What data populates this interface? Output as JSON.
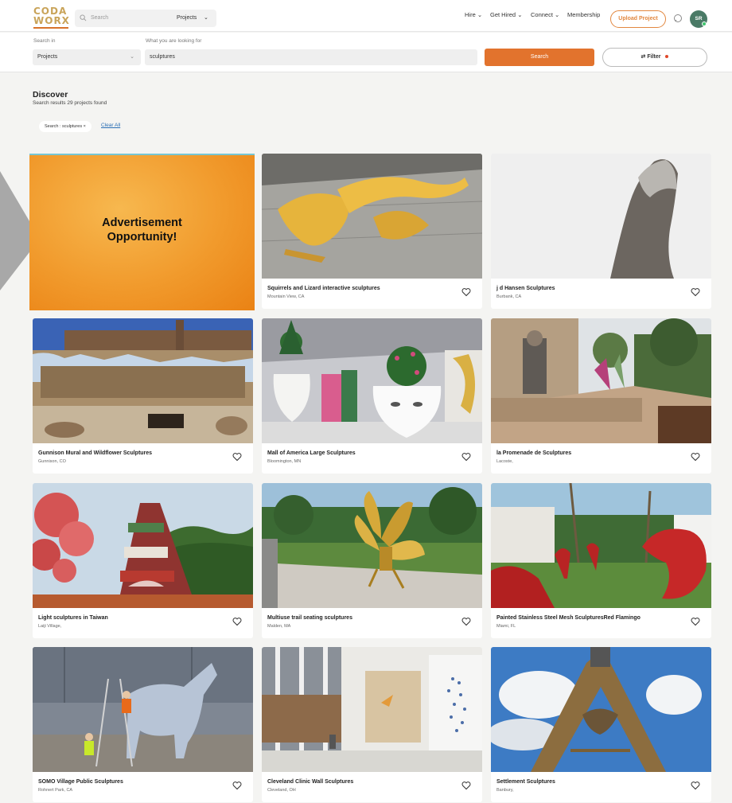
{
  "header": {
    "logo_line1": "CODA",
    "logo_line2": "WORX",
    "search_placeholder": "Search",
    "search_scope": "Projects",
    "nav": [
      "Hire",
      "Get Hired",
      "Connect",
      "Membership"
    ],
    "upload_label": "Upload Project",
    "avatar_initials": "SR"
  },
  "search": {
    "search_in_label": "Search in",
    "search_in_value": "Projects",
    "what_label": "What you are looking for",
    "what_value": "sculptures",
    "search_button": "Search",
    "filter_button": "Filter"
  },
  "discover": {
    "title": "Discover",
    "subtitle": "Search results 29 projects found",
    "chip": "Search : sculptures",
    "clear_all": "Clear All"
  },
  "ad": {
    "line1": "Advertisement",
    "line2": "Opportunity!"
  },
  "cards": [
    {
      "title": "Squirrels and Lizard interactive sculptures",
      "location": "Mountain View, CA"
    },
    {
      "title": "j d Hansen Sculptures",
      "location": "Burbank, CA"
    },
    {
      "title": "Gunnison Mural and Wildflower Sculptures",
      "location": "Gunnison, CO"
    },
    {
      "title": "Mall of America Large Sculptures",
      "location": "Bloomington, MN"
    },
    {
      "title": "la Promenade de Sculptures",
      "location": "Lacoste,"
    },
    {
      "title": "Light sculptures in Taiwan",
      "location": "Laiji Village,"
    },
    {
      "title": "Multiuse trail seating sculptures",
      "location": "Malden, MA"
    },
    {
      "title": "Painted Stainless Steel Mesh SculpturesRed Flamingo",
      "location": "Miami, FL"
    },
    {
      "title": "SOMO Village Public Sculptures",
      "location": "Rohnert Park, CA"
    },
    {
      "title": "Cleveland Clinic Wall Sculptures",
      "location": "Cleveland, OH"
    },
    {
      "title": "Settlement Sculptures",
      "location": "Banbury,"
    }
  ],
  "colors": {
    "accent": "#e2732d",
    "ad_orange": "#f19a2c"
  }
}
